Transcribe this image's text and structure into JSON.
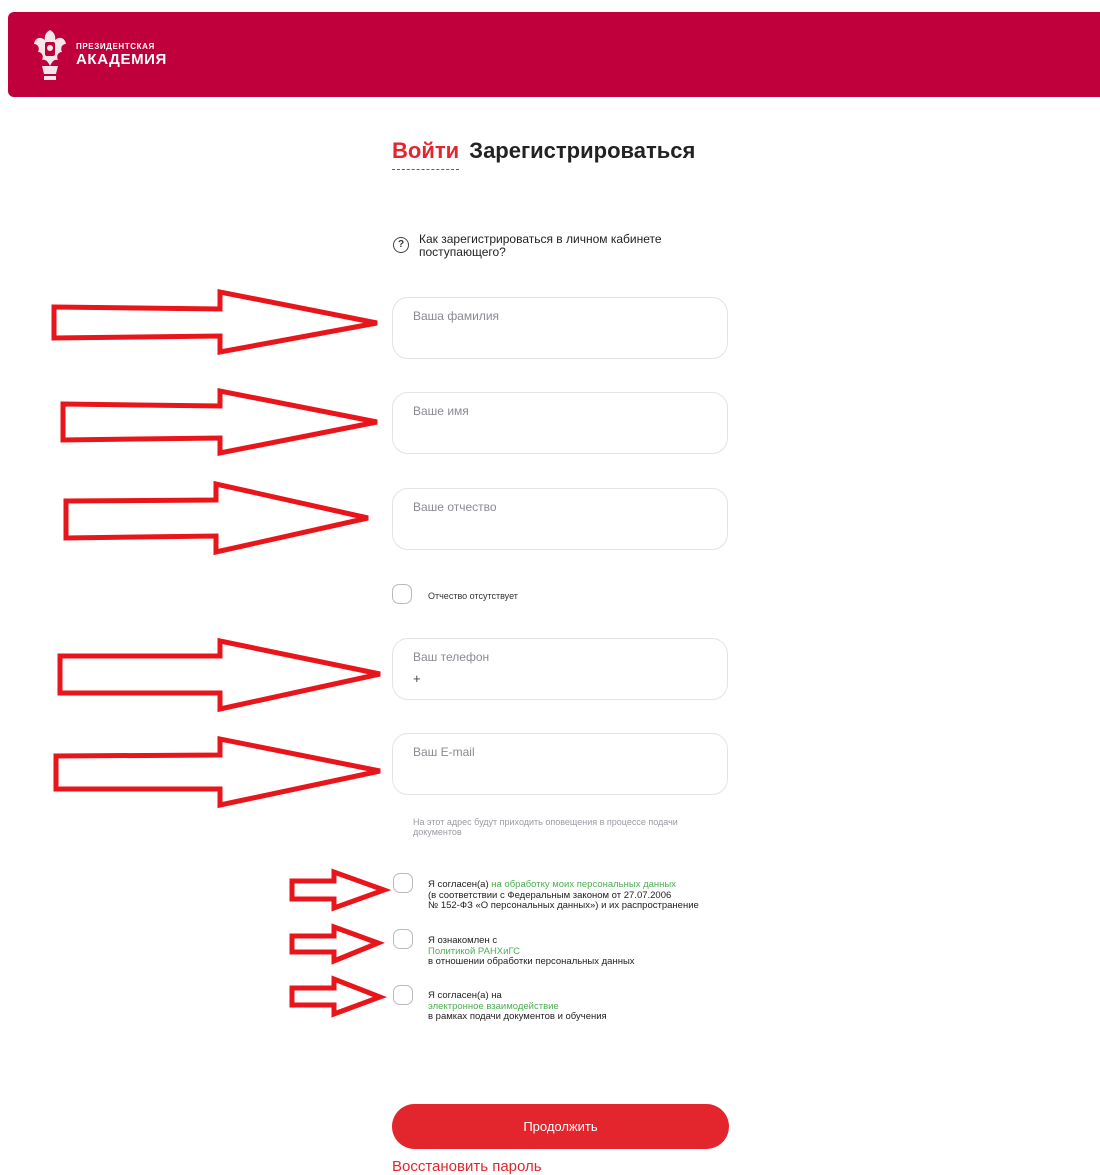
{
  "header": {
    "logo_line1": "ПРЕЗИДЕНТСКАЯ",
    "logo_line2": "АКАДЕМИЯ",
    "bg_color": "#c0003c"
  },
  "tabs": {
    "login": "Войти",
    "register": "Зарегистрироваться"
  },
  "help": {
    "icon": "question-circle-icon",
    "text": "Как зарегистрироваться в личном кабинете поступающего?"
  },
  "fields": {
    "last_name": {
      "label": "Ваша фамилия",
      "value": ""
    },
    "first_name": {
      "label": "Ваше имя",
      "value": ""
    },
    "middle_name": {
      "label": "Ваше отчество",
      "value": ""
    },
    "phone": {
      "label": "Ваш телефон",
      "value": "+"
    },
    "email": {
      "label": "Ваш E-mail",
      "value": ""
    }
  },
  "no_middle_name_label": "Отчество отсутствует",
  "email_hint": "На этот адрес будут приходить оповещения в процессе подачи документов",
  "consents": {
    "personal_data": {
      "prefix": "Я согласен(а) ",
      "link": "на обработку моих персональных данных",
      "line2": "(в соответствии с Федеральным законом от 27.07.2006",
      "line3": "№ 152-ФЗ «О персональных данных») и их распространение"
    },
    "policy": {
      "line1": "Я ознакомлен с",
      "link": "Политикой РАНХиГС",
      "line3": "в отношении обработки персональных данных"
    },
    "electronic": {
      "line1": "Я согласен(а) на",
      "link": "электронное взаимодействие",
      "line3": "в рамках подачи документов и обучения"
    }
  },
  "submit_label": "Продолжить",
  "restore_label": "Восстановить пароль",
  "colors": {
    "accent": "#e3262d",
    "link_green": "#4caf50",
    "annotation_arrow": "#e8151b"
  }
}
